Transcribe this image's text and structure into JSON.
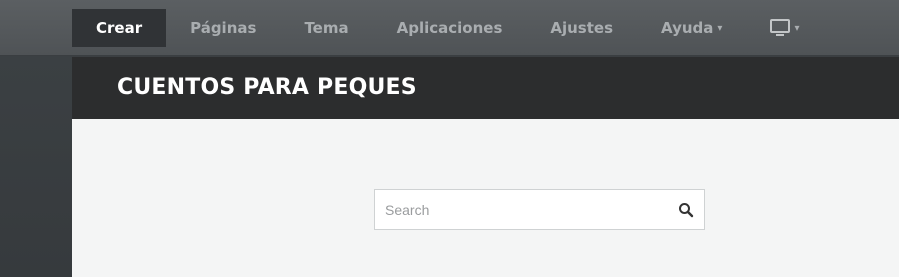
{
  "topbar": {
    "nav": [
      {
        "label": "Crear",
        "active": true
      },
      {
        "label": "Páginas",
        "active": false
      },
      {
        "label": "Tema",
        "active": false
      },
      {
        "label": "Aplicaciones",
        "active": false
      },
      {
        "label": "Ajustes",
        "active": false
      },
      {
        "label": "Ayuda",
        "active": false,
        "has_dropdown": true
      }
    ],
    "device_toggle": {
      "icon": "monitor-icon",
      "has_dropdown": true
    }
  },
  "site": {
    "title": "CUENTOS PARA PEQUES"
  },
  "search": {
    "placeholder": "Search",
    "value": "",
    "icon": "search-icon"
  },
  "colors": {
    "topbar_bg": "#555a5d",
    "active_nav_bg": "#303336",
    "header_bg": "#2c2d2e",
    "content_bg": "#f4f5f5"
  }
}
